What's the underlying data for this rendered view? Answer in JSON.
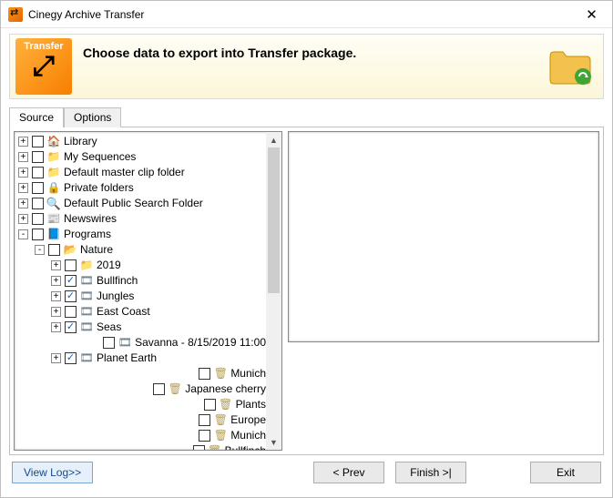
{
  "window": {
    "title": "Cinegy Archive Transfer"
  },
  "banner": {
    "logo_text": "Transfer",
    "heading": "Choose data to export into Transfer package."
  },
  "tabs": {
    "source": "Source",
    "options": "Options"
  },
  "tree": [
    {
      "d": 0,
      "t": "+",
      "chk": "",
      "icon": "home",
      "name": "Library"
    },
    {
      "d": 0,
      "t": "+",
      "chk": "",
      "icon": "fld",
      "name": "My Sequences"
    },
    {
      "d": 0,
      "t": "+",
      "chk": "",
      "icon": "fld",
      "name": "Default master clip folder"
    },
    {
      "d": 0,
      "t": "+",
      "chk": "",
      "icon": "private",
      "name": "Private folders"
    },
    {
      "d": 0,
      "t": "+",
      "chk": "",
      "icon": "search",
      "name": "Default Public Search Folder"
    },
    {
      "d": 0,
      "t": "+",
      "chk": "",
      "icon": "news",
      "name": "Newswires"
    },
    {
      "d": 0,
      "t": "-",
      "chk": "",
      "icon": "prog",
      "name": "Programs"
    },
    {
      "d": 1,
      "t": "-",
      "chk": "",
      "icon": "fld-open",
      "name": "Nature"
    },
    {
      "d": 2,
      "t": "+",
      "chk": "",
      "icon": "fld",
      "name": "2019"
    },
    {
      "d": 2,
      "t": "+",
      "chk": "✓",
      "icon": "reel",
      "name": "Bullfinch"
    },
    {
      "d": 2,
      "t": "+",
      "chk": "✓",
      "icon": "reel",
      "name": "Jungles"
    },
    {
      "d": 2,
      "t": "+",
      "chk": "",
      "icon": "reel",
      "name": "East Coast"
    },
    {
      "d": 2,
      "t": "+",
      "chk": "✓",
      "icon": "reel",
      "name": "Seas"
    },
    {
      "d": 2,
      "t": "",
      "chk": "",
      "icon": "reel",
      "name": "Savanna - 8/15/2019 11:00"
    },
    {
      "d": 2,
      "t": "+",
      "chk": "✓",
      "icon": "reel",
      "name": "Planet Earth"
    },
    {
      "d": 2,
      "t": "",
      "chk": "",
      "icon": "bin",
      "name": "Munich"
    },
    {
      "d": 2,
      "t": "",
      "chk": "",
      "icon": "bin",
      "name": "Japanese cherry"
    },
    {
      "d": 2,
      "t": "",
      "chk": "",
      "icon": "bin",
      "name": "Plants"
    },
    {
      "d": 2,
      "t": "",
      "chk": "",
      "icon": "bin",
      "name": "Europe"
    },
    {
      "d": 2,
      "t": "",
      "chk": "",
      "icon": "bin",
      "name": "Munich"
    },
    {
      "d": 2,
      "t": "",
      "chk": "",
      "icon": "bin",
      "name": "Bullfinch"
    }
  ],
  "icons": {
    "home": "🏠",
    "fld": "📁",
    "fld-open": "📂",
    "private": "🔒",
    "search": "🔍",
    "news": "📰",
    "prog": "📘",
    "reel": "🎞",
    "bin": "🗑"
  },
  "buttons": {
    "viewlog": "View Log>>",
    "prev": "< Prev",
    "finish": "Finish >|",
    "exit": "Exit"
  }
}
